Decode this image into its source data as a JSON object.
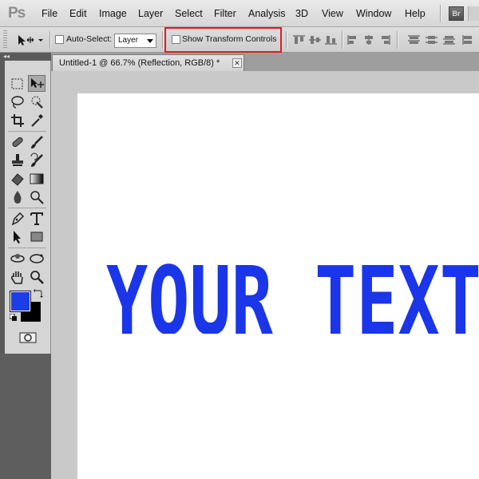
{
  "app": {
    "logo": "Ps"
  },
  "menu": [
    "File",
    "Edit",
    "Image",
    "Layer",
    "Select",
    "Filter",
    "Analysis",
    "3D",
    "View",
    "Window",
    "Help"
  ],
  "bridge_button": {
    "label": "Br"
  },
  "options_bar": {
    "auto_select_label": "Auto-Select:",
    "auto_select_checked": false,
    "auto_select_target": "Layer",
    "show_transform_label": "Show Transform Controls",
    "show_transform_checked": false,
    "highlight_color": "#e31c23"
  },
  "document": {
    "tab_title": "Untitled-1 @ 66.7% (Reflection, RGB/8) *",
    "close_symbol": "✕"
  },
  "toolbox": {
    "collapse_symbol": "◂◂",
    "tools": [
      "rect-marquee",
      "move",
      "lasso",
      "quick-select",
      "crop",
      "eyedropper",
      "healing-brush",
      "brush",
      "clone-stamp",
      "history-brush",
      "eraser",
      "gradient",
      "blur",
      "dodge",
      "pen",
      "type",
      "path-select",
      "rectangle-shape",
      "3d-rotate",
      "3d-orbit",
      "hand",
      "zoom"
    ],
    "foreground_color": "#1c3ee6",
    "background_color": "#000000"
  },
  "artwork": {
    "text": "YOUR TEXT",
    "color": "#1a36e8"
  }
}
